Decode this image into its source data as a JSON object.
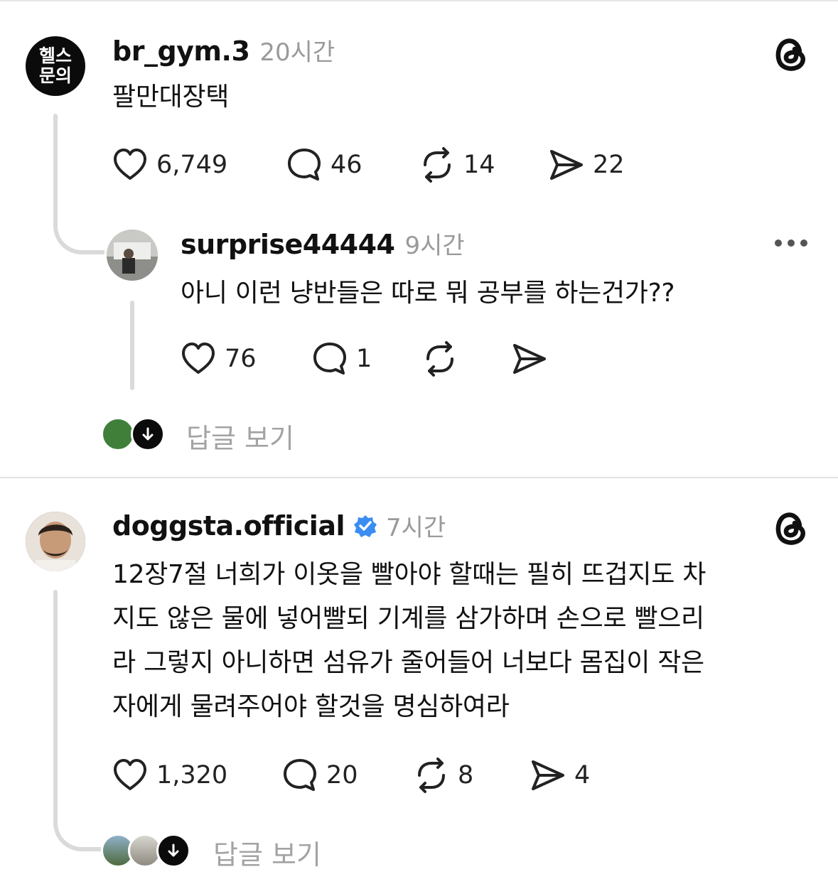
{
  "post1": {
    "avatar_text_line1": "헬스",
    "avatar_text_line2": "문의",
    "username": "br_gym.3",
    "time": "20시간",
    "text": "팔만대장택",
    "likes": "6,749",
    "comments": "46",
    "reposts": "14",
    "shares": "22"
  },
  "reply1": {
    "username": "surprise44444",
    "time": "9시간",
    "text": "아니 이런 냥반들은 따로 뭐 공부를 하는건가??",
    "likes": "76",
    "comments": "1"
  },
  "view_replies_label": "답글 보기",
  "post2": {
    "username": "doggsta.official",
    "verified": true,
    "time": "7시간",
    "text_lines": [
      "12장7절 너희가 이옷을 빨아야 할때는 필히 뜨겁지도 차",
      "지도 않은 물에 넣어빨되 기계를 삼가하며 손으로 빨으리",
      "라 그렇지 아니하면 섬유가 줄어들어 너보다 몸집이 작은",
      "자에게 물려주어야 할것을 명심하여라"
    ],
    "likes": "1,320",
    "comments": "20",
    "reposts": "8",
    "shares": "4"
  },
  "colors": {
    "verified": "#3a8df2",
    "muted": "#9a9a9a",
    "line": "#dadada"
  },
  "icons": [
    "threads-logo-icon",
    "heart-icon",
    "comment-icon",
    "repost-icon",
    "share-icon",
    "more-icon",
    "verified-badge-icon",
    "arrow-down-icon"
  ]
}
